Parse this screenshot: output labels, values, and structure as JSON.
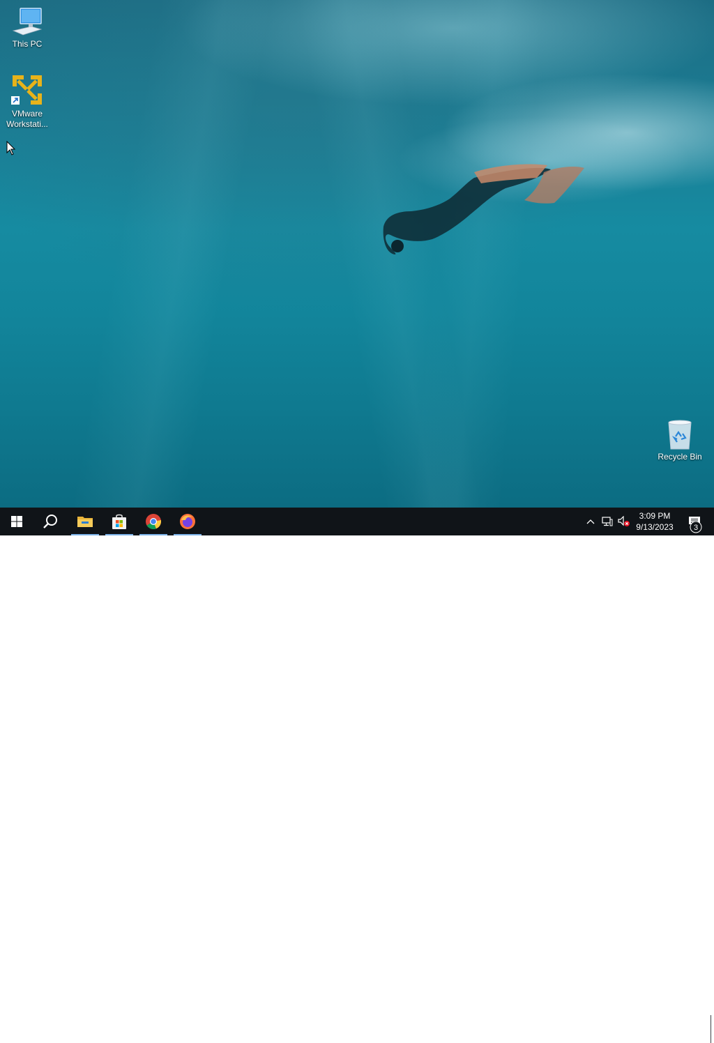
{
  "desktop": {
    "icons": [
      {
        "label": "This PC",
        "icon": "this-pc-icon"
      },
      {
        "label": "VMware Workstati...",
        "icon": "vmware-icon"
      },
      {
        "label": "Recycle Bin",
        "icon": "recycle-bin-icon"
      }
    ]
  },
  "taskbar": {
    "start": {
      "icon": "windows-logo-icon"
    },
    "search": {
      "icon": "search-icon"
    },
    "apps": [
      {
        "name": "File Explorer",
        "icon": "file-explorer-icon",
        "active": true
      },
      {
        "name": "Microsoft Store",
        "icon": "store-icon",
        "active": true
      },
      {
        "name": "Google Chrome",
        "icon": "chrome-icon",
        "active": true
      },
      {
        "name": "Firefox",
        "icon": "firefox-icon",
        "active": true
      }
    ],
    "tray": {
      "chevron_icon": "chevron-up-icon",
      "network_icon": "network-icon",
      "volume_icon": "volume-muted-icon",
      "time": "3:09 PM",
      "date": "9/13/2023",
      "notification_count": "3"
    }
  },
  "colors": {
    "taskbar": "#101418",
    "active_indicator": "#7eb4ea",
    "vmware_yellow": "#e8b31a"
  }
}
